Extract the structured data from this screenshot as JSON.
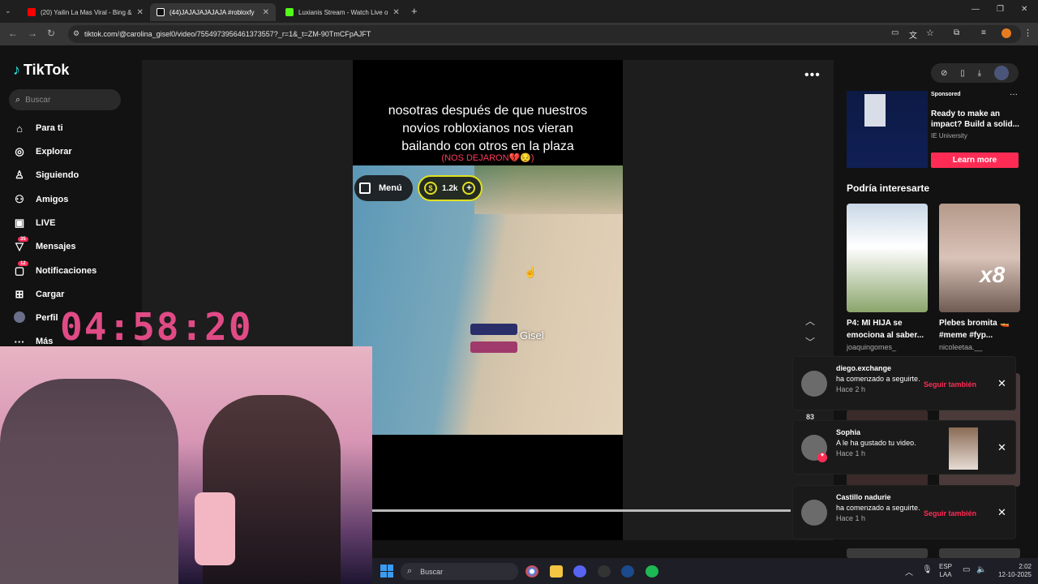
{
  "browser": {
    "tabs": [
      {
        "label": "(20) Yailin La Mas Viral - Bing &",
        "color": "#ff0000"
      },
      {
        "label": "(44)JAJAJAJAJAJA #robloxfy",
        "color": "#ffffff"
      },
      {
        "label": "Luxianis Stream - Watch Live o",
        "color": "#53fc18"
      }
    ],
    "url": "tiktok.com/@carolina_gisel0/video/7554973956461373557?_r=1&_t=ZM-90TmCFpAJFT"
  },
  "tiktok": {
    "logo": "TikTok",
    "search_placeholder": "Buscar",
    "nav": [
      {
        "label": "Para ti",
        "icon": "home-icon"
      },
      {
        "label": "Explorar",
        "icon": "compass-icon"
      },
      {
        "label": "Siguiendo",
        "icon": "following-icon"
      },
      {
        "label": "Amigos",
        "icon": "friends-icon"
      },
      {
        "label": "LIVE",
        "icon": "live-icon"
      },
      {
        "label": "Mensajes",
        "icon": "messages-icon",
        "badge": "35"
      },
      {
        "label": "Notificaciones",
        "icon": "bell-icon",
        "badge": "12"
      },
      {
        "label": "Cargar",
        "icon": "upload-icon"
      },
      {
        "label": "Perfil",
        "icon": "avatar-icon"
      },
      {
        "label": "Más",
        "icon": "more-icon"
      }
    ],
    "video": {
      "caption_lines": [
        "nosotras después de que nuestros",
        "novios robloxianos nos vieran",
        "bailando con otros en la plaza"
      ],
      "subcaption": "(NOS DEJARON💔😔)",
      "menu_label": "Menú",
      "coins": "1.2k",
      "player_name": "Gisel"
    },
    "ad": {
      "sponsored": "Sponsored",
      "title": "Ready to make an impact? Build a solid...",
      "org": "IE University",
      "cta": "Learn more"
    },
    "recommended": {
      "heading": "Podría interesarte",
      "items": [
        {
          "title": "P4: MI HIJA se emociona al saber...",
          "user": "joaquingomes_"
        },
        {
          "title": "Plebes bromita 🚤 #meme #fyp...",
          "user": "nicoleetaa.__"
        }
      ]
    },
    "side_count": "83",
    "notifications": [
      {
        "name": "diego.exchange",
        "text": "ha comenzado a seguirte.",
        "time": "Hace 2 h",
        "action": "Seguir también"
      },
      {
        "name": "Sophia",
        "text": "A le ha gustado tu video.",
        "time": "Hace 1 h",
        "action": ""
      },
      {
        "name": "Castillo nadurie",
        "text": "ha comenzado a seguirte.",
        "time": "Hace 1 h",
        "action": "Seguir también"
      }
    ]
  },
  "stream": {
    "timer": "04:58:20"
  },
  "taskbar": {
    "search": "Buscar",
    "lang_1": "ESP",
    "lang_2": "LAA",
    "time": "2:02",
    "date": "12-10-2025"
  }
}
